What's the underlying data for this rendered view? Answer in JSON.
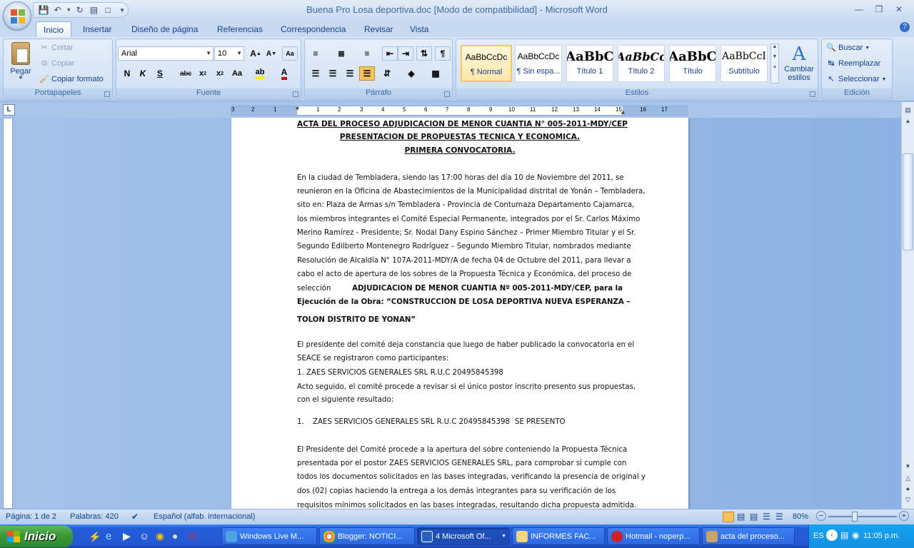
{
  "window": {
    "title": "Buena Pro Losa deportiva.doc [Modo de compatibilidad] - Microsoft Word"
  },
  "tabs": [
    "Inicio",
    "Insertar",
    "Diseño de página",
    "Referencias",
    "Correspondencia",
    "Revisar",
    "Vista"
  ],
  "clipboard": {
    "paste": "Pegar",
    "cut": "Cortar",
    "copy": "Copiar",
    "format_painter": "Copiar formato",
    "label": "Portapapeles"
  },
  "font": {
    "name": "Arial",
    "size": "10",
    "label": "Fuente",
    "bold": "N",
    "italic": "K",
    "underline": "S",
    "strike": "abc",
    "change_case": "Aa"
  },
  "paragraph": {
    "label": "Párrafo"
  },
  "styles": {
    "label": "Estilos",
    "items": [
      {
        "sample": "AaBbCcDc",
        "name": "¶ Normal"
      },
      {
        "sample": "AaBbCcDc",
        "name": "¶ Sin espa..."
      },
      {
        "sample": "AaBbC",
        "name": "Título 1"
      },
      {
        "sample": "AaBbCc",
        "name": "Título 2"
      },
      {
        "sample": "AaBbC",
        "name": "Título"
      },
      {
        "sample": "AaBbCcI",
        "name": "Subtítulo"
      }
    ],
    "change_styles": "Cambiar estilos"
  },
  "editing": {
    "find": "Buscar",
    "replace": "Reemplazar",
    "select": "Seleccionar",
    "label": "Edición"
  },
  "ruler": {
    "ticks": [
      "3",
      "2",
      "1",
      "1",
      "2",
      "3",
      "4",
      "5",
      "6",
      "7",
      "8",
      "9",
      "10",
      "11",
      "12",
      "13",
      "14",
      "15",
      "16",
      "17"
    ]
  },
  "document": {
    "heading1": "ACTA DEL PROCESO ADJUDICACION DE MENOR CUANTIA N° 005-2011-MDY/CEP",
    "heading2": "PRESENTACION DE PROPUESTAS TECNICA  Y ECONOMICA.",
    "heading3": "PRIMERA CONVOCATORIA.",
    "p1": [
      "En la ciudad de Tembladera, siendo las 17:00 horas del día 10 de Noviembre del 2011, se",
      "reunieron en la Oficina de Abastecimientos de la Municipalidad distrital de Yonán – Tembladera,",
      "sito en: Plaza de Armas s/n Tembladera - Provincia de Contumaza Departamento Cajamarca,",
      "los miembros integrantes el Comité Especial Permanente, integrados por el Sr. Carlos Máximo",
      "Merino Ramírez - Presidente; Sr. Nodal Dany Espino Sánchez – Primer Miembro Titular y el Sr.",
      "Segundo Edilberto Montenegro Rodríguez – Segundo Miembro Titular, nombrados mediante",
      "Resolución de Alcaldía N° 107A-2011-MDY/A de fecha 04 de Octubre del 2011, para llevar a",
      "cabo el acto de apertura de los sobres de la Propuesta Técnica y Económica, del proceso de"
    ],
    "p1_sel_pre": "selección",
    "p1_sel_bold": "ADJUDICACION DE MENOR CUANTIA Nº 005-2011-MDY/CEP, para la",
    "p1_line10": "Ejecución de la Obra: “CONSTRUCCION DE LOSA DEPORTIVA NUEVA ESPERANZA –",
    "p1_line11": "TOLON DISTRITO DE YONAN”",
    "p2": [
      "El presidente del comité deja constancia que luego de haber publicado la convocatoria en el",
      "SEACE se registraron como participantes:"
    ],
    "list1": "1.   ZAES SERVICIOS GENERALES SRL R.U.C 20495845398",
    "p3": [
      "Acto seguido, el comité procede a revisar si el único postor inscrito presento sus propuestas,",
      "con el siguiente resultado:"
    ],
    "list2_num": "1.",
    "list2_text": "ZAES SERVICIOS GENERALES SRL R.U.C 20495845398",
    "list2_status": "SE PRESENTO",
    "p4": [
      "El Presidente del Comité procede a la apertura del sobre conteniendo la Propuesta Técnica",
      "presentada por el postor ZAES SERVICIOS GENERALES SRL, para comprobar si cumple con",
      "todos los documentos solicitados en las bases integradas, verificando la presencia de original y",
      "dos (02) copias haciendo la entrega a los demás integrantes para su verificación de los",
      "requisitos mínimos solicitados en las bases integradas, resultando dicha propuesta admitida."
    ]
  },
  "status": {
    "page": "Página: 1 de 2",
    "words": "Palabras: 420",
    "language": "Español (alfab. internacional)",
    "zoom": "80%"
  },
  "taskbar": {
    "start": "Inicio",
    "items": [
      "Windows Live M...",
      "Blogger: NOTICI...",
      "4 Microsoft Of...",
      "INFORMES FAC...",
      "Hotmail - noperp...",
      "acta del proceso..."
    ],
    "lang": "ES",
    "clock": "11:05 p.m."
  }
}
